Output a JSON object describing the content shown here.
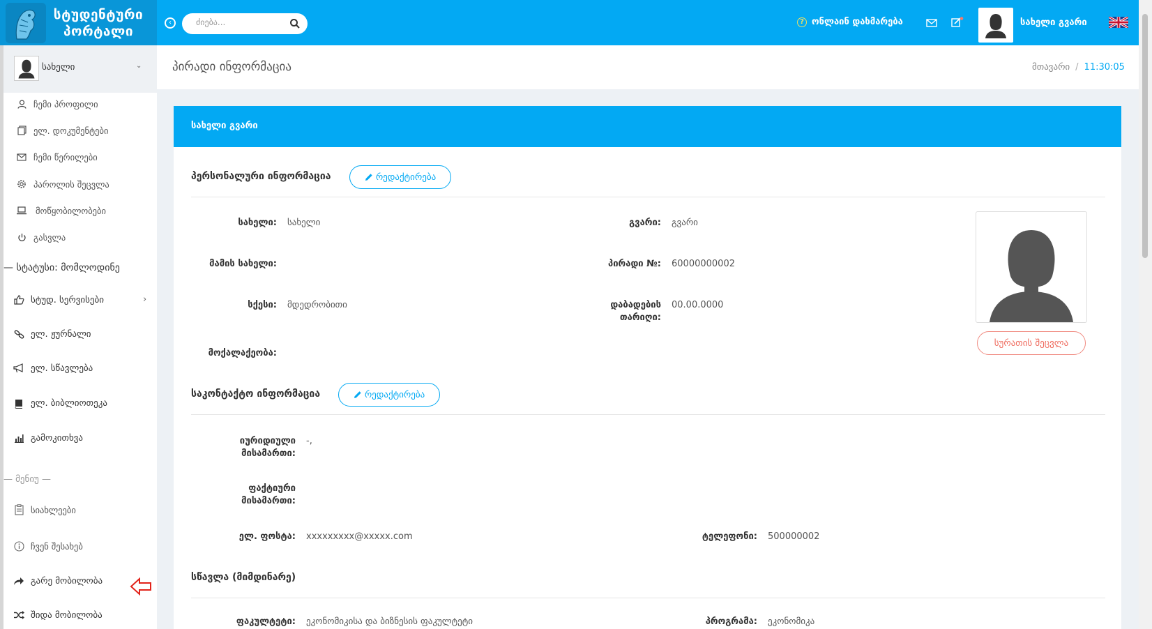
{
  "brand": {
    "line1": "სტუდენტური",
    "line2": "პორტალი"
  },
  "header": {
    "search_placeholder": "ძიება...",
    "help_label": "ონლაინ დახმარება",
    "user_name": "სახელი გვარი"
  },
  "sidebar": {
    "user_name": "სახელი",
    "profile_items": [
      {
        "label": "ჩემი პროფილი",
        "icon": "user-icon"
      },
      {
        "label": "ელ. დოკუმენტები",
        "icon": "documents-icon"
      },
      {
        "label": "ჩემი წერილები",
        "icon": "mail-icon"
      },
      {
        "label": "პაროლის შეცვლა",
        "icon": "gear-icon"
      },
      {
        "label": "მოწყობილობები",
        "icon": "laptop-icon"
      },
      {
        "label": "გასვლა",
        "icon": "power-icon"
      }
    ],
    "status": "— სტატუსი: მომლოდინე",
    "main_items": [
      {
        "label": "სტუდ. სერვისები",
        "icon": "thumbs-up-icon"
      },
      {
        "label": "ელ. ჟურნალი",
        "icon": "link-icon"
      },
      {
        "label": "ელ. სწავლება",
        "icon": "megaphone-icon"
      },
      {
        "label": "ელ. ბიბლიოთეკა",
        "icon": "book-icon"
      },
      {
        "label": "გამოკითხვა",
        "icon": "bar-chart-icon"
      }
    ],
    "menu_heading": "— მენიუ —",
    "menu_items": [
      {
        "label": "სიახლეები",
        "icon": "clipboard-icon"
      },
      {
        "label": "ჩვენ შესახებ",
        "icon": "info-icon"
      },
      {
        "label": "გარე მობილობა",
        "icon": "share-icon"
      },
      {
        "label": "შიდა მობილობა",
        "icon": "shuffle-icon"
      }
    ]
  },
  "page": {
    "title": "პირადი ინფორმაცია",
    "breadcrumb_home": "მთავარი",
    "breadcrumb_sep": "/",
    "time": "11:30:05"
  },
  "card": {
    "header": "სახელი გვარი",
    "personal": {
      "title": "პერსონალური ინფორმაცია",
      "edit_label": "რედაქტირება",
      "first_name_label": "სახელი:",
      "first_name": "სახელი",
      "last_name_label": "გვარი:",
      "last_name": "გვარი",
      "father_label": "მამის სახელი:",
      "father": "",
      "personal_no_label": "პირადი №:",
      "personal_no": "60000000002",
      "gender_label": "სქესი:",
      "gender": "მდედრობითი",
      "birth_label_1": "დაბადების",
      "birth_label_2": "თარიღი:",
      "birth": "00.00.0000",
      "citizenship_label": "მოქალაქეობა:",
      "citizenship": "",
      "photo_button": "სურათის შეცვლა"
    },
    "contact": {
      "title": "საკონტაქტო ინფორმაცია",
      "edit_label": "რედაქტირება",
      "legal_label_1": "იურიდიული",
      "legal_label_2": "მისამართი:",
      "legal": "-,",
      "actual_label_1": "ფაქტიური",
      "actual_label_2": "მისამართი:",
      "actual": "",
      "email_label": "ელ. ფოსტა:",
      "email": "xxxxxxxxx@xxxxx.com",
      "phone_label": "ტელეფონი:",
      "phone": "500000002"
    },
    "study": {
      "title": "სწავლა (მიმდინარე)",
      "faculty_label": "ფაკულტეტი:",
      "faculty": "ეკონომიკისა და ბიზნესის ფაკულტეტი",
      "program_label": "პროგრამა:",
      "program": "ეკონომიკა"
    }
  },
  "colors": {
    "primary": "#03a9f3",
    "logo_bg": "#0996d8",
    "danger": "#ef6b5e"
  }
}
